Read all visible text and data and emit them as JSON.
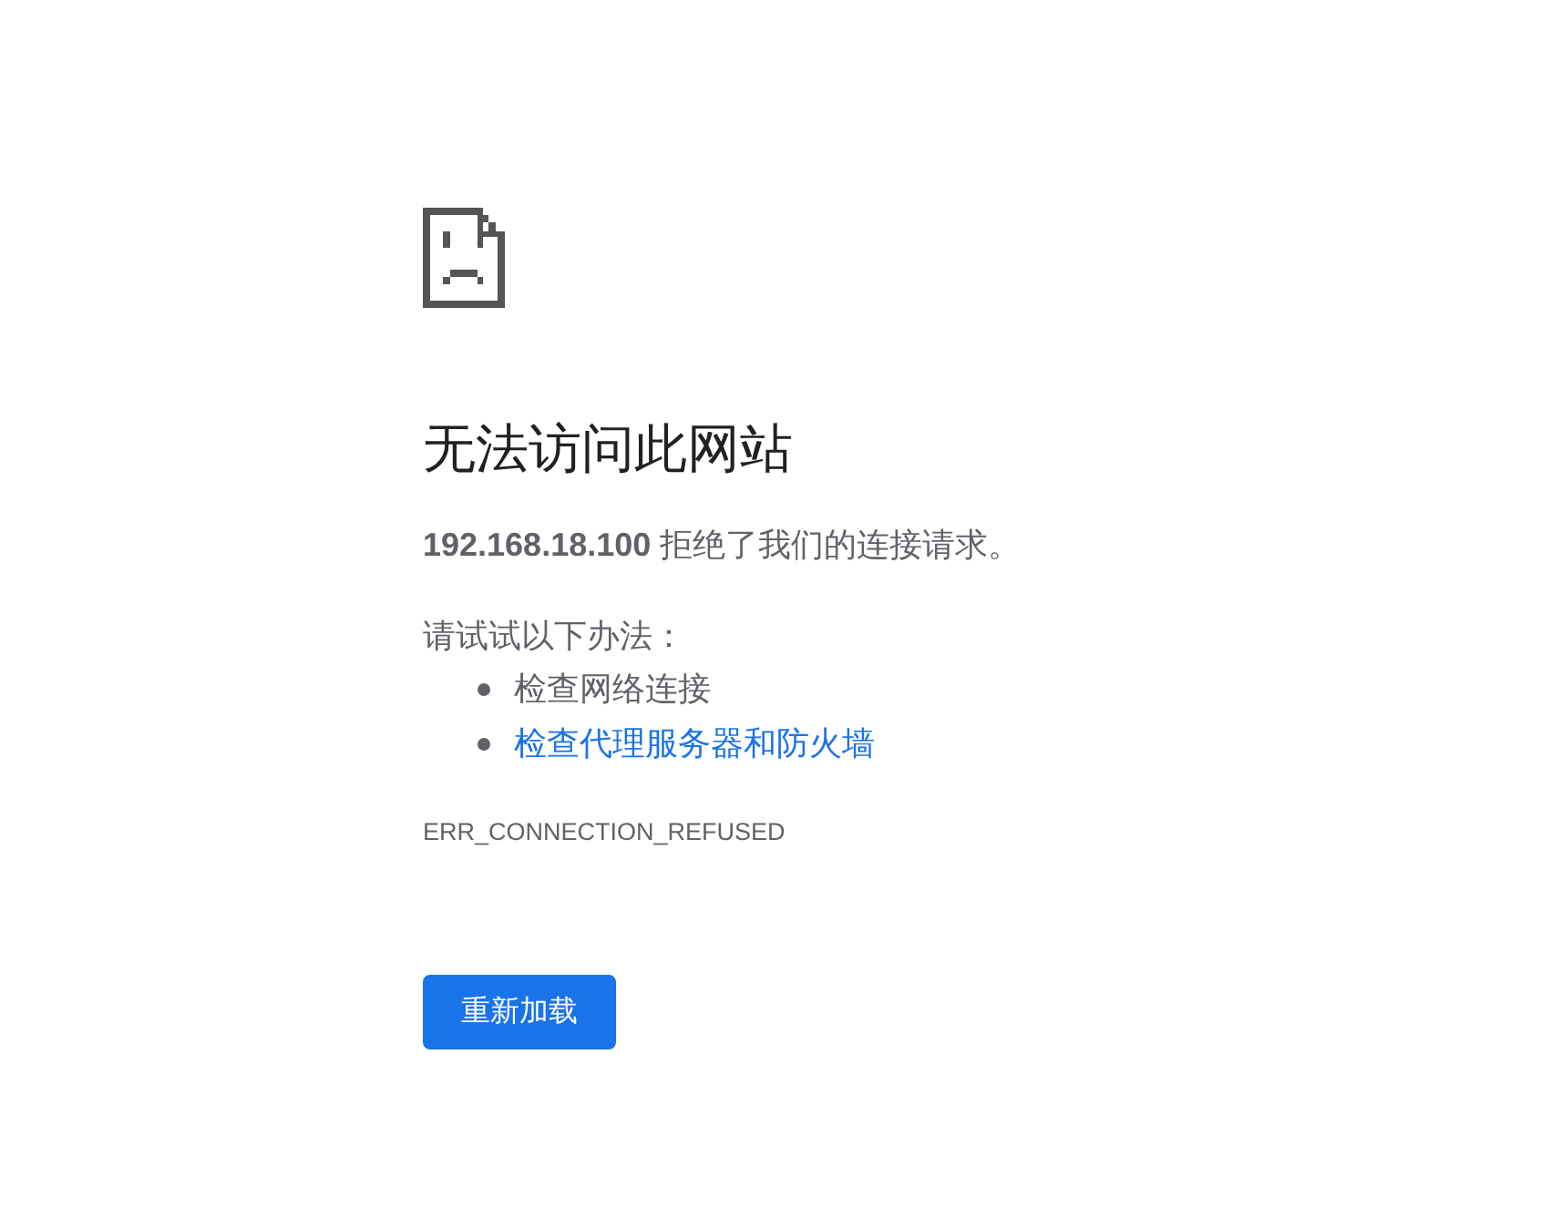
{
  "error_page": {
    "title": "无法访问此网站",
    "message": "**192.168.18.100** 拒绝了我们的连接请求。",
    "suggestions_heading": "请试试以下办法：",
    "suggestions": [
      {
        "kind": "text",
        "text": "检查网络连接"
      },
      {
        "kind": "link",
        "text": "检查代理服务器和防火墙"
      }
    ],
    "error_code": "ERR_CONNECTION_REFUSED",
    "reload_button": "重新加载"
  }
}
